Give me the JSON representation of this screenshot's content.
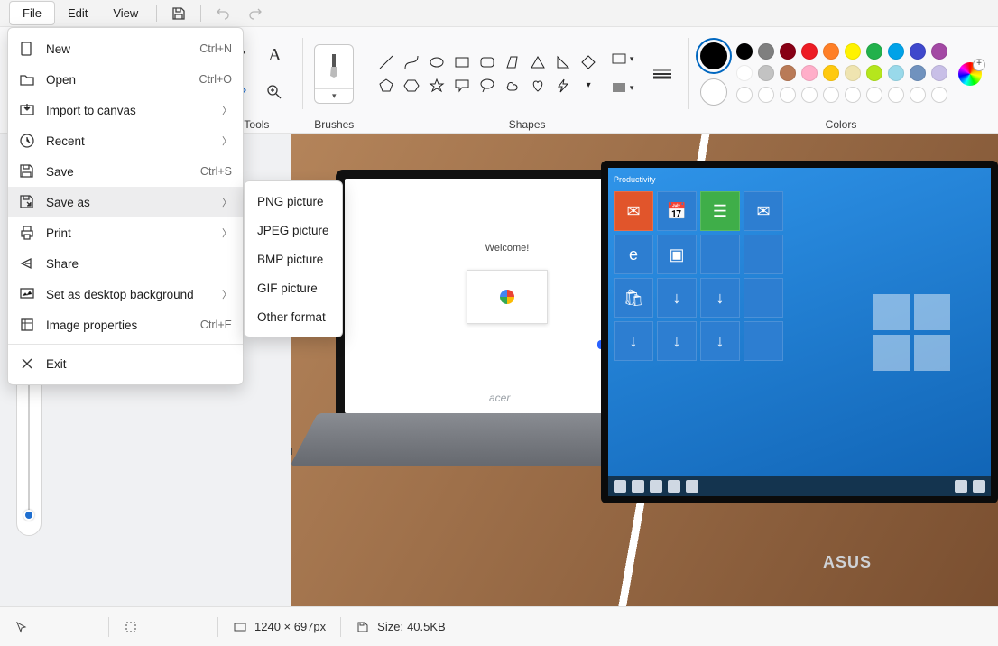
{
  "menubar": {
    "file": "File",
    "edit": "Edit",
    "view": "View"
  },
  "ribbon": {
    "tools_label": "Tools",
    "brushes_label": "Brushes",
    "shapes_label": "Shapes",
    "colors_label": "Colors"
  },
  "palette_colors": [
    "#000000",
    "#7f7f7f",
    "#880015",
    "#ed1c24",
    "#ff7f27",
    "#fff200",
    "#22b14c",
    "#00a2e8",
    "#3f48cc",
    "#a349a4",
    "#ffffff",
    "#c3c3c3",
    "#b97a57",
    "#ffaec9",
    "#ffc90e",
    "#efe4b0",
    "#b5e61d",
    "#99d9ea",
    "#7092be",
    "#c8bfe7"
  ],
  "file_menu": {
    "items": [
      {
        "icon": "file-new-icon",
        "label": "New",
        "accel": "Ctrl+N",
        "sub": false
      },
      {
        "icon": "folder-open-icon",
        "label": "Open",
        "accel": "Ctrl+O",
        "sub": false
      },
      {
        "icon": "import-icon",
        "label": "Import to canvas",
        "accel": "",
        "sub": true
      },
      {
        "icon": "recent-icon",
        "label": "Recent",
        "accel": "",
        "sub": true
      },
      {
        "icon": "save-icon",
        "label": "Save",
        "accel": "Ctrl+S",
        "sub": false
      },
      {
        "icon": "saveas-icon",
        "label": "Save as",
        "accel": "",
        "sub": true,
        "hovered": true
      },
      {
        "icon": "print-icon",
        "label": "Print",
        "accel": "",
        "sub": true
      },
      {
        "icon": "share-icon",
        "label": "Share",
        "accel": "",
        "sub": false
      },
      {
        "icon": "desktop-bg-icon",
        "label": "Set as desktop background",
        "accel": "",
        "sub": true
      },
      {
        "icon": "properties-icon",
        "label": "Image properties",
        "accel": "Ctrl+E",
        "sub": false
      },
      {
        "icon": "exit-icon",
        "label": "Exit",
        "accel": "",
        "sub": false,
        "sep_before": true
      }
    ]
  },
  "saveas_submenu": [
    "PNG picture",
    "JPEG picture",
    "BMP picture",
    "GIF picture",
    "Other format"
  ],
  "canvas": {
    "welcome_text": "Welcome!",
    "chromebook_brand": "acer",
    "winlaptop_brand": "ASUS"
  },
  "statusbar": {
    "dimensions": "1240 × 697px",
    "size_label": "Size:",
    "size_value": "40.5KB"
  }
}
